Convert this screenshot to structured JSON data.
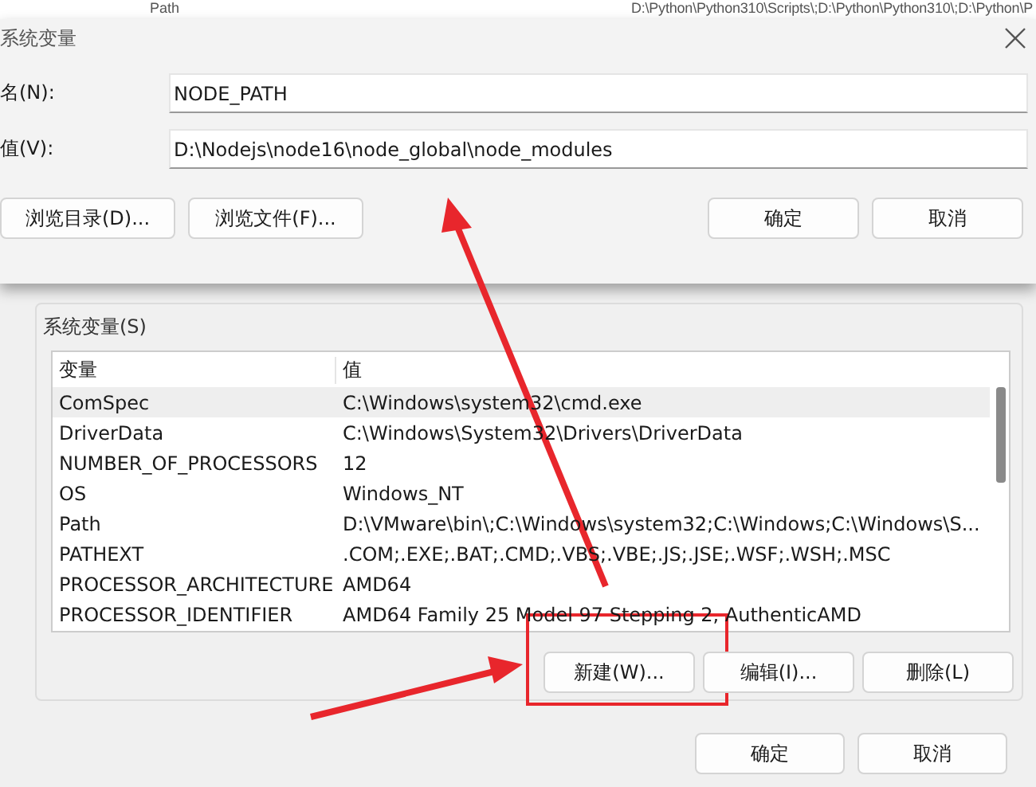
{
  "background_row": {
    "name": "Path",
    "value": "D:\\Python\\Python310\\Scripts\\;D:\\Python\\Python310\\;D:\\Python\\P"
  },
  "dialog": {
    "title": "系统变量",
    "fields": [
      {
        "label": "名(N):",
        "value": "NODE_PATH"
      },
      {
        "label": "值(V):",
        "value": "D:\\Nodejs\\node16\\node_global\\node_modules"
      }
    ],
    "left_buttons": [
      "浏览目录(D)...",
      "浏览文件(F)..."
    ],
    "right_buttons": [
      "确定",
      "取消"
    ]
  },
  "system_variables": {
    "title": "系统变量(S)",
    "columns": [
      "变量",
      "值"
    ],
    "rows": [
      {
        "name": "ComSpec",
        "value": "C:\\Windows\\system32\\cmd.exe",
        "selected": true
      },
      {
        "name": "DriverData",
        "value": "C:\\Windows\\System32\\Drivers\\DriverData",
        "selected": false
      },
      {
        "name": "NUMBER_OF_PROCESSORS",
        "value": "12",
        "selected": false
      },
      {
        "name": "OS",
        "value": "Windows_NT",
        "selected": false
      },
      {
        "name": "Path",
        "value": "D:\\VMware\\bin\\;C:\\Windows\\system32;C:\\Windows;C:\\Windows\\S...",
        "selected": false
      },
      {
        "name": "PATHEXT",
        "value": ".COM;.EXE;.BAT;.CMD;.VBS;.VBE;.JS;.JSE;.WSF;.WSH;.MSC",
        "selected": false
      },
      {
        "name": "PROCESSOR_ARCHITECTURE",
        "value": "AMD64",
        "selected": false
      },
      {
        "name": "PROCESSOR_IDENTIFIER",
        "value": "AMD64 Family 25 Model 97 Stepping 2, AuthenticAMD",
        "selected": false
      }
    ],
    "buttons": [
      "新建(W)...",
      "编辑(I)...",
      "删除(L)"
    ]
  },
  "footer_buttons": [
    "确定",
    "取消"
  ]
}
